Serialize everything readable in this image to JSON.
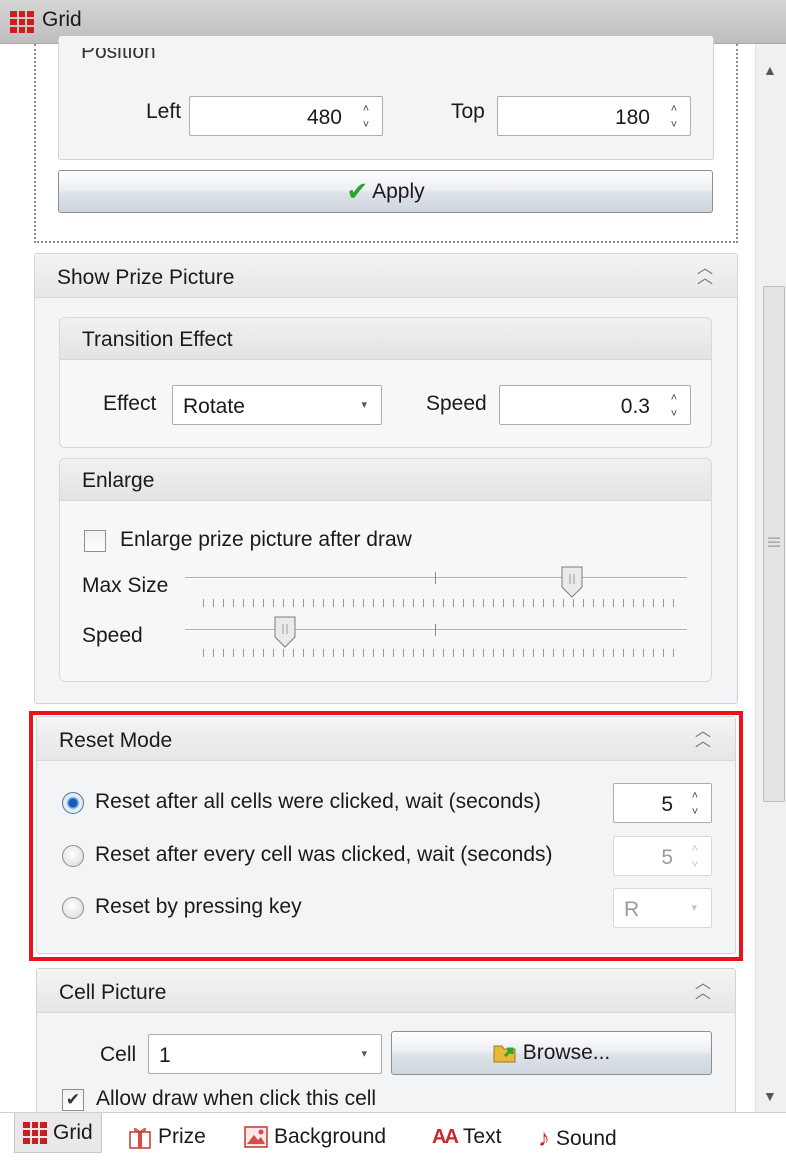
{
  "window": {
    "title": "Grid",
    "icon": "grid-icon"
  },
  "position": {
    "header": "Position",
    "left_label": "Left",
    "left_value": "480",
    "top_label": "Top",
    "top_value": "180",
    "apply_label": "Apply"
  },
  "show_prize_picture": {
    "header": "Show Prize Picture",
    "transition": {
      "header": "Transition Effect",
      "effect_label": "Effect",
      "effect_value": "Rotate",
      "speed_label": "Speed",
      "speed_value": "0.3"
    },
    "enlarge": {
      "header": "Enlarge",
      "checkbox_label": "Enlarge prize picture after draw",
      "checked": false,
      "max_size_label": "Max Size",
      "max_size_level": 0.77,
      "speed_label": "Speed",
      "speed_level": 0.2
    }
  },
  "reset_mode": {
    "header": "Reset Mode",
    "options": [
      {
        "label": "Reset after all cells were clicked, wait (seconds)",
        "selected": true,
        "value": "5"
      },
      {
        "label": "Reset after every cell was clicked, wait (seconds)",
        "selected": false,
        "value": "5"
      },
      {
        "label": "Reset by pressing key",
        "selected": false,
        "value": "R"
      }
    ]
  },
  "cell_picture": {
    "header": "Cell Picture",
    "cell_label": "Cell",
    "cell_value": "1",
    "browse_label": "Browse...",
    "allow_draw_label": "Allow draw when click this cell",
    "allow_draw_checked": true
  },
  "tabs": [
    {
      "label": "Grid",
      "icon": "grid-icon",
      "active": true
    },
    {
      "label": "Prize",
      "icon": "gift-icon",
      "active": false
    },
    {
      "label": "Background",
      "icon": "image-icon",
      "active": false
    },
    {
      "label": "Text",
      "icon": "text-icon",
      "active": false
    },
    {
      "label": "Sound",
      "icon": "music-note-icon",
      "active": false
    }
  ],
  "colors": {
    "highlight": "#e8141c",
    "accent_check": "#2ea52e",
    "grid_icon": "#cc1e1e"
  }
}
